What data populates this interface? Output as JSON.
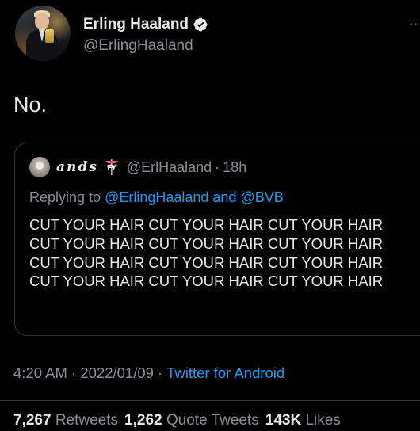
{
  "author": {
    "display_name": "Erling Haaland",
    "handle": "@ErlingHaaland",
    "verified_icon": "verified-badge-icon",
    "avatar_icon": "profile-photo-avatar"
  },
  "tweet": {
    "text": "No.",
    "timestamp": "4:20 AM",
    "separator": "·",
    "date": "2022/01/09",
    "source": "Twitter for Android"
  },
  "quote": {
    "display_name": "ands",
    "emoji_icon": "carousel-horse-icon",
    "handle": "@ErlHaaland",
    "separator": "·",
    "time": "18h",
    "replying_prefix": "Replying to ",
    "replying_to_1": "@ErlingHaaland",
    "replying_and": " and ",
    "replying_to_2": "@BVB",
    "body": "CUT YOUR HAIR CUT YOUR HAIR CUT YOUR HAIR CUT YOUR HAIR CUT YOUR HAIR CUT YOUR HAIR CUT YOUR HAIR CUT YOUR HAIR CUT YOUR HAIR CUT YOUR HAIR CUT YOUR HAIR CUT YOUR HAIR"
  },
  "stats": {
    "retweets_count": "7,267",
    "retweets_label": "Retweets",
    "quote_tweets_count": "1,262",
    "quote_tweets_label": "Quote Tweets",
    "likes_count": "143K",
    "likes_label": "Likes"
  },
  "colors": {
    "background": "#000000",
    "text_primary": "#e7e9ea",
    "text_secondary": "#8b9096",
    "link": "#1d9bf0",
    "border": "#2f3336"
  }
}
